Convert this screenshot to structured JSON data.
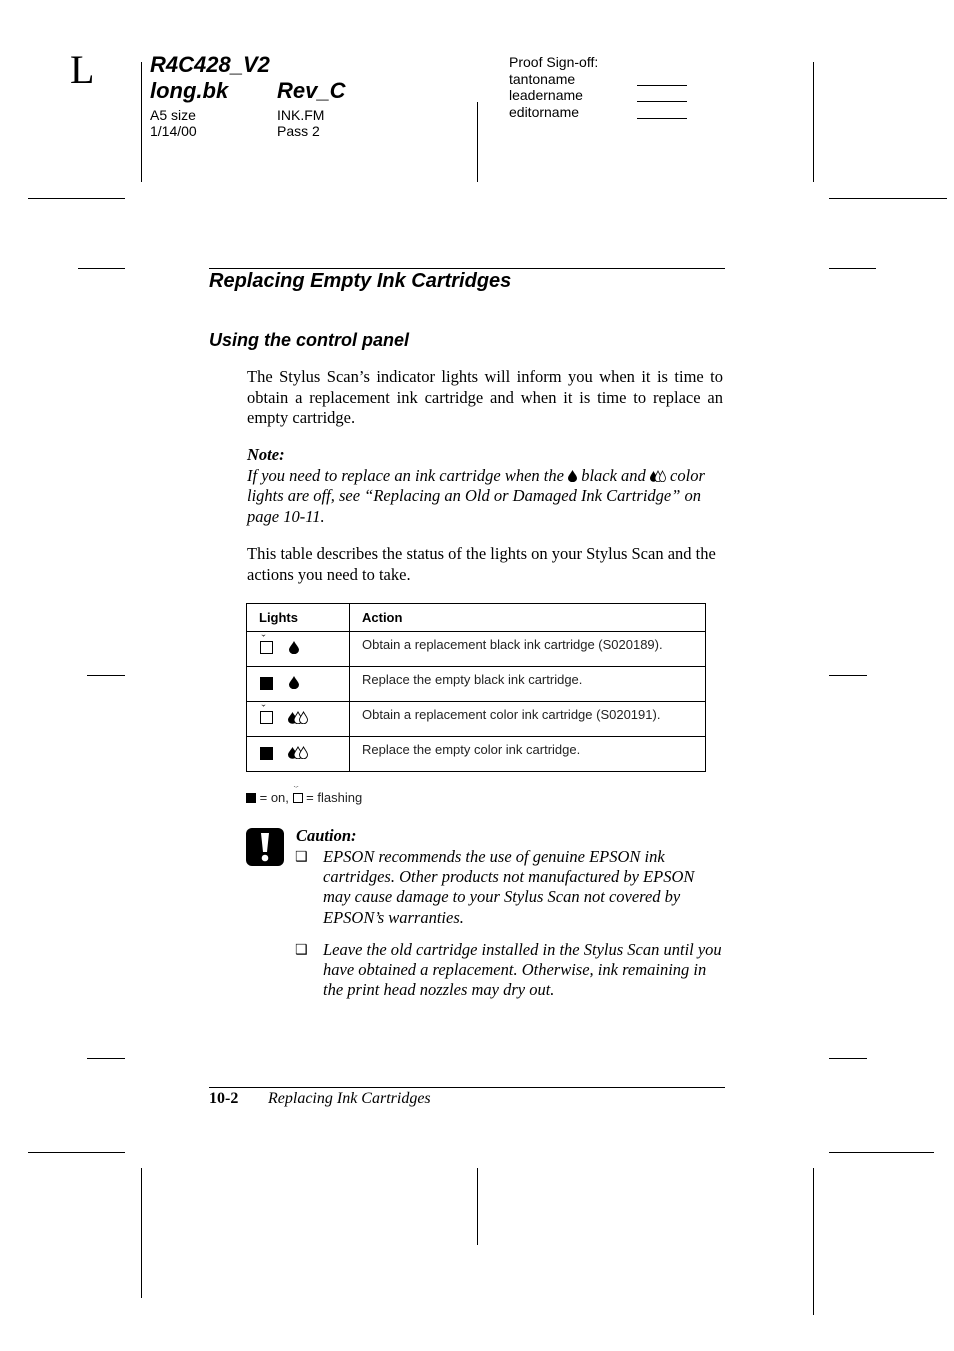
{
  "header": {
    "page_side_mark": "L",
    "project_code": "R4C428_V2",
    "book_file": "long.bk",
    "revision": "Rev_C",
    "page_size": "A5 size",
    "date": "1/14/00",
    "source_file": "INK.FM",
    "pass": "Pass 2",
    "proof": {
      "title": "Proof Sign-off:",
      "signers": [
        "tantoname",
        "leadername",
        "editorname"
      ]
    }
  },
  "section": {
    "title": "Replacing Empty Ink Cartridges",
    "subtitle": "Using the control panel",
    "intro": "The Stylus Scan’s indicator lights will inform you when it is time to obtain a replacement ink cartridge and when it is time to replace an empty cartridge.",
    "note": {
      "label": "Note:",
      "text_part1": "If you need to replace an ink cartridge when the",
      "text_part2": "black and",
      "text_part3": "color lights are off, see “Replacing an Old or Damaged Ink Cartridge” on page 10-11."
    },
    "table_intro": "This table describes the status of the lights on your Stylus Scan and the actions you need to take."
  },
  "table": {
    "headers": [
      "Lights",
      "Action"
    ],
    "rows": [
      {
        "light_state": "flashing",
        "ink": "black",
        "action": "Obtain a replacement black ink cartridge (S020189)."
      },
      {
        "light_state": "on",
        "ink": "black",
        "action": "Replace the empty black ink cartridge."
      },
      {
        "light_state": "flashing",
        "ink": "color",
        "action": "Obtain a replacement color ink cartridge (S020191)."
      },
      {
        "light_state": "on",
        "ink": "color",
        "action": "Replace the empty color ink cartridge."
      }
    ]
  },
  "legend": {
    "on_text": "= on,",
    "flashing_text": "= flashing"
  },
  "caution": {
    "label": "Caution:",
    "items": [
      "EPSON recommends the use of genuine EPSON ink cartridges. Other products not manufactured by EPSON may cause damage to your Stylus Scan not covered by EPSON’s warranties.",
      "Leave the old cartridge installed in the Stylus Scan until you have obtained a replacement. Otherwise, ink remaining in the print head nozzles may dry out."
    ],
    "bullet_glyph": "❑"
  },
  "footer": {
    "page_number": "10-2",
    "chapter_title": "Replacing Ink Cartridges"
  }
}
